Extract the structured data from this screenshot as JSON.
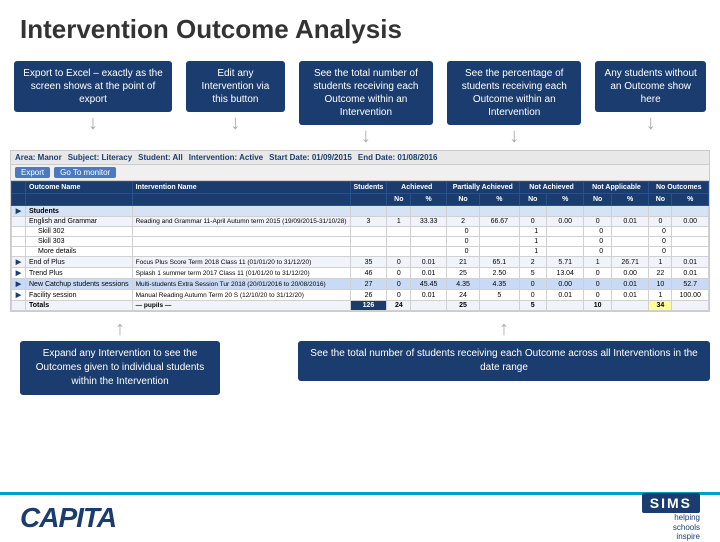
{
  "page": {
    "title": "Intervention Outcome Analysis"
  },
  "annotations": {
    "top_left": "Export to Excel – exactly as the screen shows at the point of export",
    "top_center_left": "Edit any Intervention via this button",
    "top_center": "See the total number of students receiving each Outcome within an Intervention",
    "top_center_right": "See the percentage of students receiving each Outcome within an Intervention",
    "top_right": "Any students without an Outcome show here",
    "bottom_left": "Expand any Intervention to see the Outcomes given to individual students within the Intervention",
    "bottom_right": "See the total number of students receiving each Outcome across all Interventions in the date range"
  },
  "filter_bar": {
    "area": "Area: Manor",
    "subject": "Subject: Literacy",
    "student": "Student: All",
    "intervention": "Intervention: Active",
    "start_date": "Start Date: 01/09/2015",
    "end_date": "End Date: 01/08/2016"
  },
  "table": {
    "columns": [
      "",
      "Outcome Name",
      "Intervention Name",
      "Students",
      "Achieved",
      "",
      "Partially Achieved",
      "",
      "Not Achieved",
      "",
      "Not Applicable",
      "",
      "No Outcome",
      ""
    ],
    "col_sub": [
      "",
      "",
      "",
      "",
      "No",
      "%",
      "No",
      "%",
      "No",
      "%",
      "No",
      "%",
      "No",
      "%"
    ],
    "rows": [
      {
        "type": "group",
        "expand": true,
        "outcome": "Students",
        "intervention": "",
        "students": "",
        "ach_no": "",
        "ach_pct": "",
        "part_no": "",
        "part_pct": "",
        "notach_no": "",
        "notach_pct": "",
        "na_no": "",
        "na_pct": "",
        "noout_no": "",
        "noout_pct": ""
      },
      {
        "type": "data",
        "expand": false,
        "outcome": "English and Grammar",
        "intervention": "Reading and Grammar 11-April Autumn term 2015 (19/09/2015-31/10/28)",
        "students": "3",
        "ach_no": "1",
        "ach_pct": "33.33",
        "part_no": "2",
        "part_pct": "66.67",
        "notach_no": "0",
        "notach_pct": "0.00",
        "na_no": "0",
        "na_pct": "0.01",
        "noout_no": "0",
        "noout_pct": "0.00"
      },
      {
        "type": "sub",
        "expand": false,
        "outcome": "Skill 302",
        "intervention": "",
        "students": "",
        "ach_no": "",
        "ach_pct": "",
        "part_no": "0",
        "part_pct": "",
        "notach_no": "1",
        "notach_pct": "",
        "na_no": "0",
        "na_pct": "",
        "noout_no": "0",
        "noout_pct": ""
      },
      {
        "type": "sub",
        "expand": false,
        "outcome": "Skill 303",
        "intervention": "",
        "students": "",
        "ach_no": "",
        "ach_pct": "",
        "part_no": "0",
        "part_pct": "",
        "notach_no": "1",
        "notach_pct": "",
        "na_no": "0",
        "na_pct": "",
        "noout_no": "0",
        "noout_pct": ""
      },
      {
        "type": "sub",
        "expand": false,
        "outcome": "More details",
        "intervention": "",
        "students": "",
        "ach_no": "",
        "ach_pct": "",
        "part_no": "0",
        "part_pct": "",
        "notach_no": "1",
        "notach_pct": "",
        "na_no": "0",
        "na_pct": "",
        "noout_no": "0",
        "noout_pct": ""
      },
      {
        "type": "data",
        "expand": true,
        "outcome": "End of Plus",
        "intervention": "Focus Plus Score Term 2018 Class 11 (01/01/20 to 31/12/20)",
        "students": "35",
        "ach_no": "0",
        "ach_pct": "0.01",
        "part_no": "21",
        "part_pct": "65.1",
        "notach_no": "2",
        "notach_pct": "5.71",
        "na_no": "1",
        "na_pct": "26.71",
        "noout_no": "1",
        "noout_pct": "0.01"
      },
      {
        "type": "data",
        "expand": true,
        "outcome": "Trend Plus",
        "intervention": "Splash 1 summer term 2017 Class 11 (01/01/20 to 31/12/20)",
        "students": "46",
        "ach_no": "0",
        "ach_pct": "0.01",
        "part_no": "25",
        "part_pct": "2.50",
        "notach_no": "5",
        "notach_pct": "13.04",
        "na_no": "0",
        "na_pct": "0.00",
        "noout_no": "22",
        "noout_pct": "0.01"
      },
      {
        "type": "highlight",
        "expand": true,
        "outcome": "New Catchup students sessions",
        "intervention": "Multi-students Extra Session Tur 2018 (20/01/2016 to 20/08/2016)",
        "students": "27",
        "ach_no": "0",
        "ach_pct": "45.45",
        "part_no": "4.35",
        "part_pct": "4.35",
        "notach_no": "0",
        "notach_pct": "0.00",
        "na_no": "0",
        "na_pct": "0.01",
        "noout_no": "10",
        "noout_pct": "52.7"
      },
      {
        "type": "data",
        "expand": true,
        "outcome": "Facility session",
        "intervention": "Manual Reading Autumn Term 20 S (12/10/20 to 31/12/20)",
        "students": "26",
        "ach_no": "0",
        "ach_pct": "0.01",
        "part_no": "24",
        "part_pct": "5",
        "notach_no": "0",
        "notach_pct": "0.01",
        "na_no": "0",
        "na_pct": "0.01",
        "noout_no": "1",
        "noout_pct": "100.00"
      },
      {
        "type": "totals",
        "expand": false,
        "outcome": "Totals",
        "intervention": "— pupils —",
        "students": "126",
        "ach_no": "24",
        "ach_pct": "",
        "part_no": "25",
        "part_pct": "",
        "notach_no": "5",
        "notach_pct": "",
        "na_no": "10",
        "na_pct": "",
        "noout_no": "34",
        "noout_pct": ""
      }
    ]
  },
  "footer": {
    "company": "CAPITA",
    "product": "SIMS",
    "tagline": "helping\nschools\ninspire"
  }
}
